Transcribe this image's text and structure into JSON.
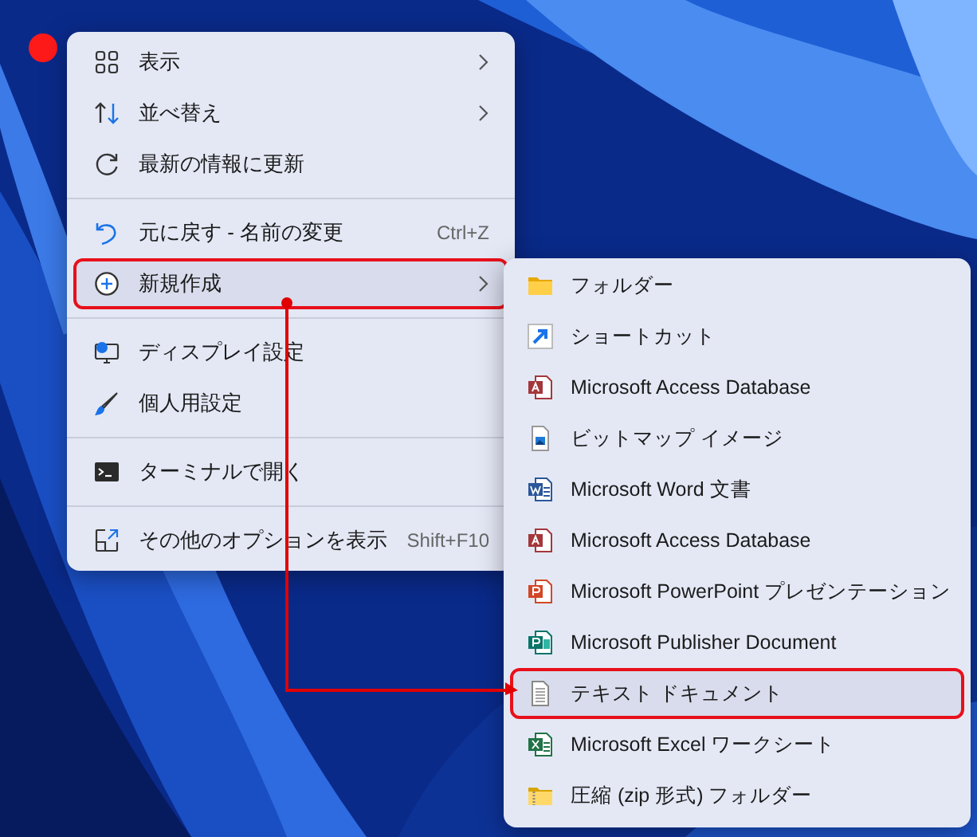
{
  "main_menu": {
    "groups": [
      [
        {
          "label": "表示",
          "has_submenu": true,
          "selected": false
        },
        {
          "label": "並べ替え",
          "has_submenu": true,
          "selected": false
        },
        {
          "label": "最新の情報に更新",
          "has_submenu": false,
          "selected": false
        }
      ],
      [
        {
          "label": "元に戻す - 名前の変更",
          "shortcut": "Ctrl+Z",
          "has_submenu": false,
          "selected": false
        },
        {
          "label": "新規作成",
          "has_submenu": true,
          "selected": true
        }
      ],
      [
        {
          "label": "ディスプレイ設定",
          "has_submenu": false,
          "selected": false
        },
        {
          "label": "個人用設定",
          "has_submenu": false,
          "selected": false
        }
      ],
      [
        {
          "label": "ターミナルで開く",
          "has_submenu": false,
          "selected": false
        }
      ],
      [
        {
          "label": "その他のオプションを表示",
          "shortcut": "Shift+F10",
          "has_submenu": false,
          "selected": false
        }
      ]
    ]
  },
  "submenu": {
    "items": [
      {
        "label": "フォルダー",
        "selected": false
      },
      {
        "label": "ショートカット",
        "selected": false
      },
      {
        "label": "Microsoft Access Database",
        "selected": false
      },
      {
        "label": "ビットマップ イメージ",
        "selected": false
      },
      {
        "label": "Microsoft Word 文書",
        "selected": false
      },
      {
        "label": "Microsoft Access Database",
        "selected": false
      },
      {
        "label": "Microsoft PowerPoint プレゼンテーション",
        "selected": false
      },
      {
        "label": "Microsoft Publisher Document",
        "selected": false
      },
      {
        "label": "テキスト ドキュメント",
        "selected": true
      },
      {
        "label": "Microsoft Excel ワークシート",
        "selected": false
      },
      {
        "label": "圧縮 (zip 形式) フォルダー",
        "selected": false
      }
    ]
  }
}
